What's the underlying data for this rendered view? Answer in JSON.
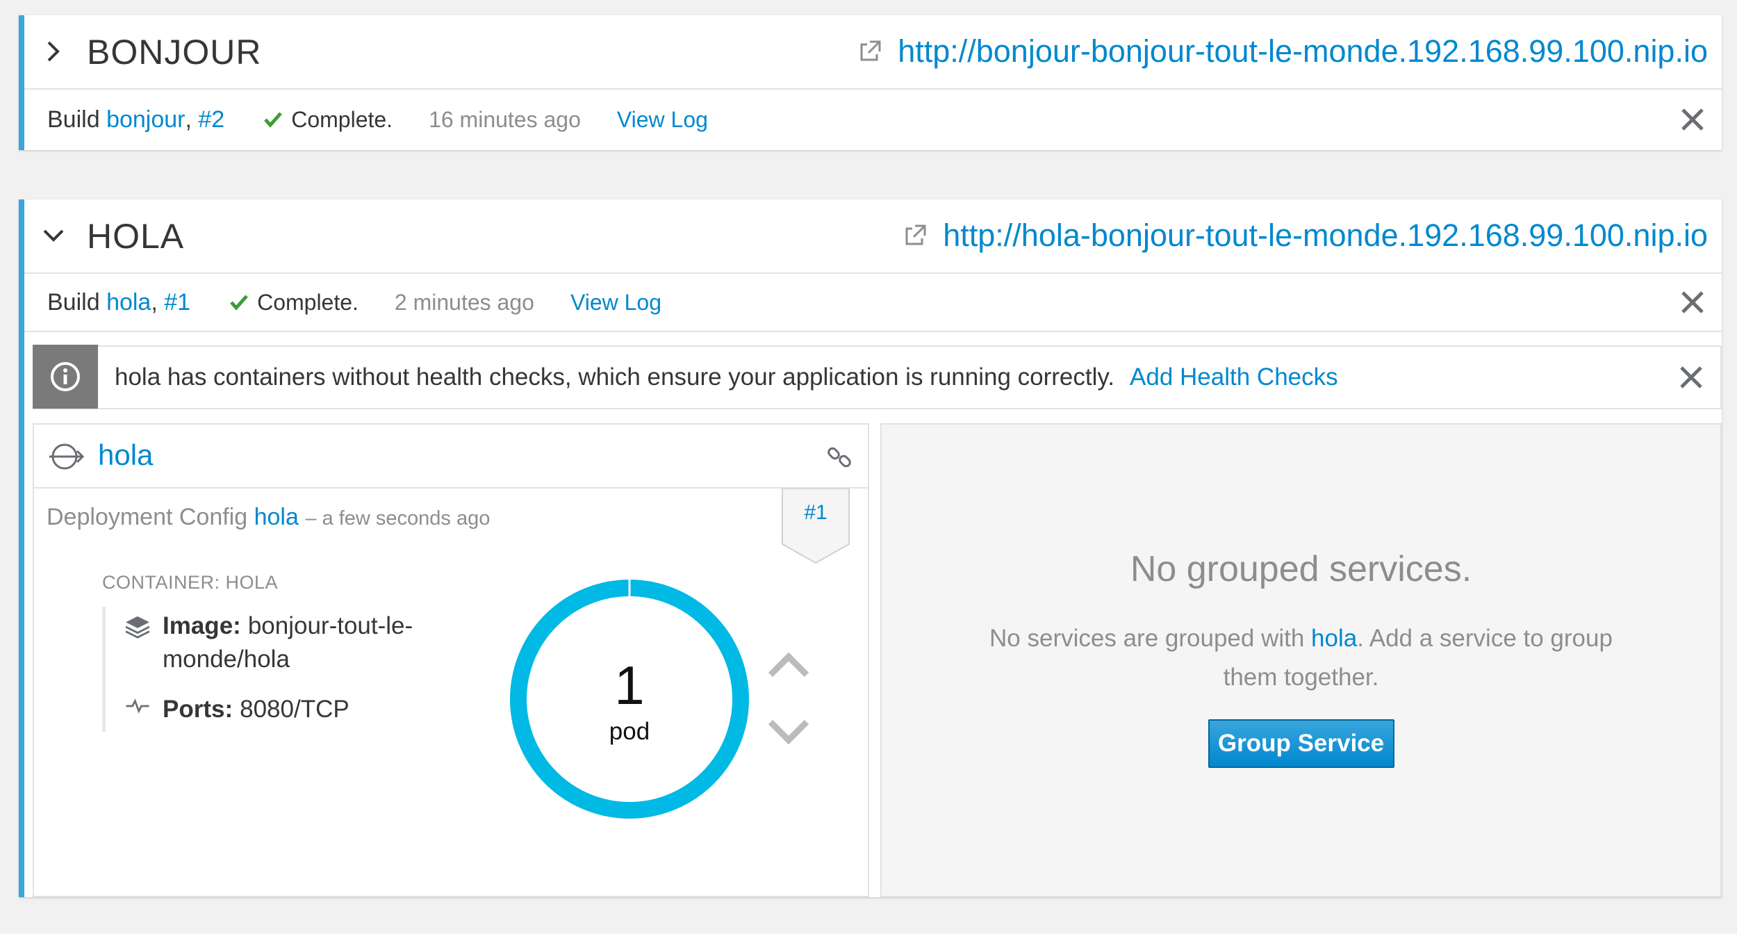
{
  "apps": {
    "bonjour": {
      "name": "BONJOUR",
      "route": "http://bonjour-bonjour-tout-le-monde.192.168.99.100.nip.io",
      "build": {
        "prefix": "Build",
        "name": "bonjour",
        "number": "#2",
        "status": "Complete.",
        "time": "16 minutes ago",
        "view_log": "View Log"
      }
    },
    "hola": {
      "name": "HOLA",
      "route": "http://hola-bonjour-tout-le-monde.192.168.99.100.nip.io",
      "build": {
        "prefix": "Build",
        "name": "hola",
        "number": "#1",
        "status": "Complete.",
        "time": "2 minutes ago",
        "view_log": "View Log"
      },
      "alert": {
        "message": "hola has containers without health checks, which ensure your application is running correctly.",
        "action": "Add Health Checks"
      },
      "deployment": {
        "name": "hola",
        "config_label": "Deployment Config",
        "config_name": "hola",
        "config_time": "– a few seconds ago",
        "badge": "#1",
        "container_label": "CONTAINER: HOLA",
        "image_label": "Image:",
        "image_value_1": "bonjour-tout-le-",
        "image_value_2": "monde/hola",
        "ports_label": "Ports:",
        "ports_value": "8080/TCP",
        "pod_count": "1",
        "pod_unit": "pod"
      },
      "services": {
        "title": "No grouped services.",
        "desc_before": "No services are grouped with",
        "desc_link": "hola",
        "desc_after": ". Add a service to group them together.",
        "button": "Group Service"
      }
    }
  },
  "colors": {
    "accent": "#39a5dc",
    "link": "#0088ce",
    "donut": "#00b9e4",
    "success": "#3f9c35"
  }
}
